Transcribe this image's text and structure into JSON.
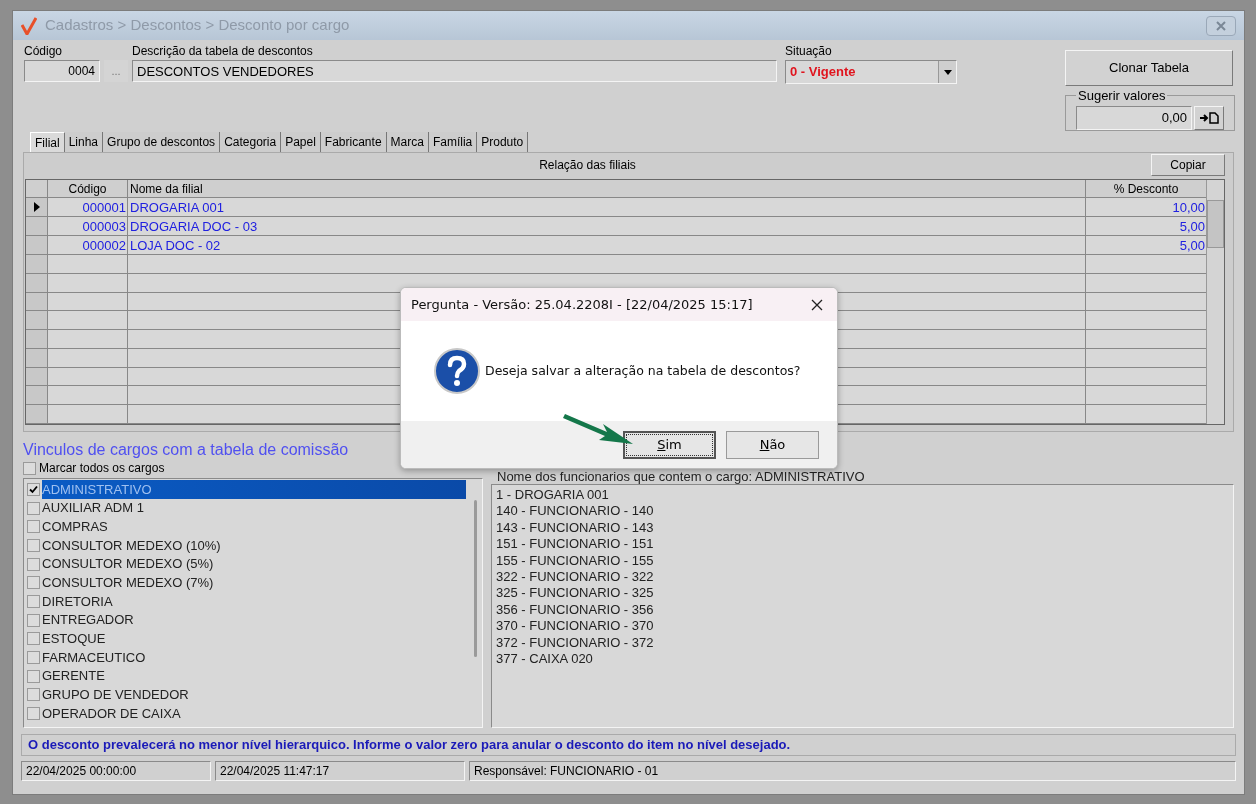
{
  "window": {
    "title": "Cadastros > Descontos > Desconto por cargo"
  },
  "header": {
    "code_label": "Código",
    "code_value": "0004",
    "lookup_button": "...",
    "description_label": "Descrição da tabela de descontos",
    "description_value": "DESCONTOS VENDEDORES",
    "status_label": "Situação",
    "status_value": "0 - Vigente",
    "clone_button": "Clonar Tabela",
    "suggest_label": "Sugerir valores",
    "suggest_value": "0,00"
  },
  "tabs": [
    {
      "label": "Filial",
      "selected": true
    },
    {
      "label": "Linha",
      "selected": false
    },
    {
      "label": "Grupo de descontos",
      "selected": false
    },
    {
      "label": "Categoria",
      "selected": false
    },
    {
      "label": "Papel",
      "selected": false
    },
    {
      "label": "Fabricante",
      "selected": false
    },
    {
      "label": "Marca",
      "selected": false
    },
    {
      "label": "Família",
      "selected": false
    },
    {
      "label": "Produto",
      "selected": false
    }
  ],
  "grid": {
    "title": "Relação das filiais",
    "copy_button": "Copiar",
    "columns": [
      "Código",
      "Nome da filial",
      "% Desconto"
    ],
    "rows": [
      {
        "code": "000001",
        "name": "DROGARIA 001",
        "discount": "10,00",
        "selected": true
      },
      {
        "code": "000003",
        "name": "DROGARIA DOC - 03",
        "discount": "5,00",
        "selected": false
      },
      {
        "code": "000002",
        "name": "LOJA  DOC - 02",
        "discount": "5,00",
        "selected": false
      }
    ]
  },
  "positions": {
    "title": "Vinculos de cargos com a tabela de comissão",
    "select_all": {
      "label": "Marcar todos os cargos",
      "checked": false
    },
    "items": [
      {
        "label": "ADMINISTRATIVO",
        "checked": true,
        "selected": true
      },
      {
        "label": "AUXILIAR ADM 1",
        "checked": false,
        "selected": false
      },
      {
        "label": "COMPRAS",
        "checked": false,
        "selected": false
      },
      {
        "label": "CONSULTOR MEDEXO (10%)",
        "checked": false,
        "selected": false
      },
      {
        "label": "CONSULTOR MEDEXO (5%)",
        "checked": false,
        "selected": false
      },
      {
        "label": "CONSULTOR MEDEXO (7%)",
        "checked": false,
        "selected": false
      },
      {
        "label": "DIRETORIA",
        "checked": false,
        "selected": false
      },
      {
        "label": "ENTREGADOR",
        "checked": false,
        "selected": false
      },
      {
        "label": "ESTOQUE",
        "checked": false,
        "selected": false
      },
      {
        "label": "FARMACEUTICO",
        "checked": false,
        "selected": false
      },
      {
        "label": "GERENTE",
        "checked": false,
        "selected": false
      },
      {
        "label": "GRUPO DE VENDEDOR",
        "checked": false,
        "selected": false
      },
      {
        "label": "OPERADOR DE CAIXA",
        "checked": false,
        "selected": false
      }
    ]
  },
  "employees": {
    "title": "Nome dos funcionarios que contem o cargo: ADMINISTRATIVO",
    "items": [
      "1 - DROGARIA 001",
      "140 - FUNCIONARIO - 140",
      "143 - FUNCIONARIO - 143",
      "151 - FUNCIONARIO - 151",
      "155 - FUNCIONARIO - 155",
      "322 - FUNCIONARIO - 322",
      "325 - FUNCIONARIO - 325",
      "356 - FUNCIONARIO - 356",
      "370 - FUNCIONARIO - 370",
      "372 - FUNCIONARIO - 372",
      "377 - CAIXA 020"
    ]
  },
  "note": "O desconto prevalecerá no menor nível hierarquico. Informe o valor zero para anular o desconto do item no nível desejado.",
  "status_bar": [
    "22/04/2025 00:00:00",
    "22/04/2025 11:47:17",
    "Responsável: FUNCIONARIO - 01"
  ],
  "dialog": {
    "title": "Pergunta - Versão: 25.04.2208I - [22/04/2025 15:17]",
    "message": "Deseja salvar a alteração na tabela de descontos?",
    "buttons": [
      {
        "label": "Sim",
        "selected": true
      },
      {
        "label": "Não",
        "selected": false
      }
    ]
  }
}
